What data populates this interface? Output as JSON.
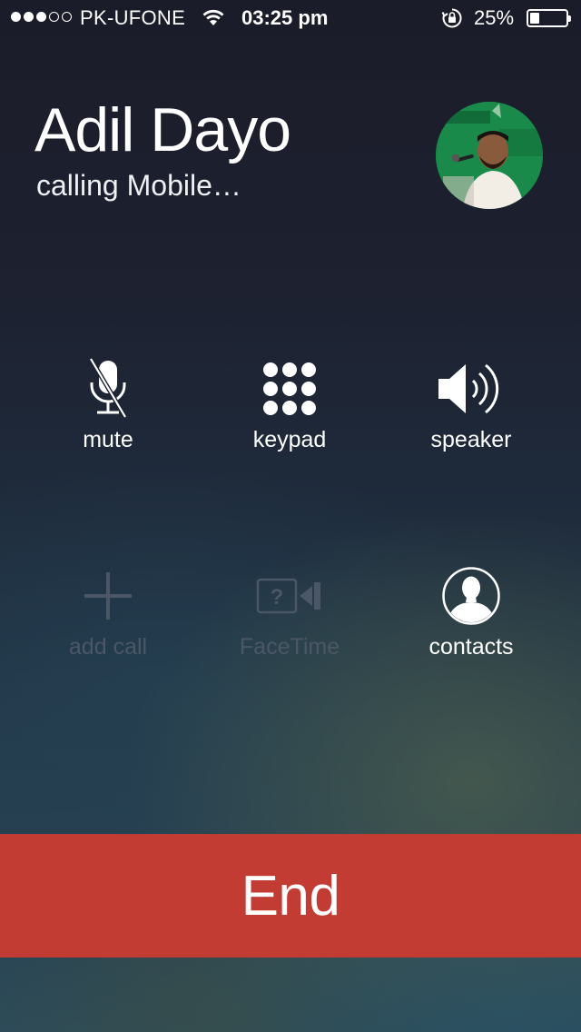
{
  "status_bar": {
    "signal_bars": 3,
    "signal_total": 5,
    "carrier": "PK-UFONE",
    "time": "03:25 pm",
    "battery_percent": "25%",
    "battery_level": 0.25,
    "icons": [
      "wifi-icon",
      "orientation-lock-icon",
      "battery-icon"
    ]
  },
  "caller": {
    "name": "Adil Dayo",
    "status": "calling Mobile…"
  },
  "controls": {
    "mute": {
      "label": "mute",
      "icon": "microphone-muted-icon",
      "enabled": true
    },
    "keypad": {
      "label": "keypad",
      "icon": "keypad-grid-icon",
      "enabled": true
    },
    "speaker": {
      "label": "speaker",
      "icon": "speaker-icon",
      "enabled": true
    },
    "add_call": {
      "label": "add call",
      "icon": "plus-icon",
      "enabled": false
    },
    "facetime": {
      "label": "FaceTime",
      "icon": "facetime-camera-icon",
      "enabled": false
    },
    "contacts": {
      "label": "contacts",
      "icon": "contact-silhouette-icon",
      "enabled": true
    }
  },
  "end_call": {
    "label": "End"
  },
  "colors": {
    "end_button": "#c23c34",
    "disabled_text": "#4b5766",
    "text": "#ffffff"
  }
}
